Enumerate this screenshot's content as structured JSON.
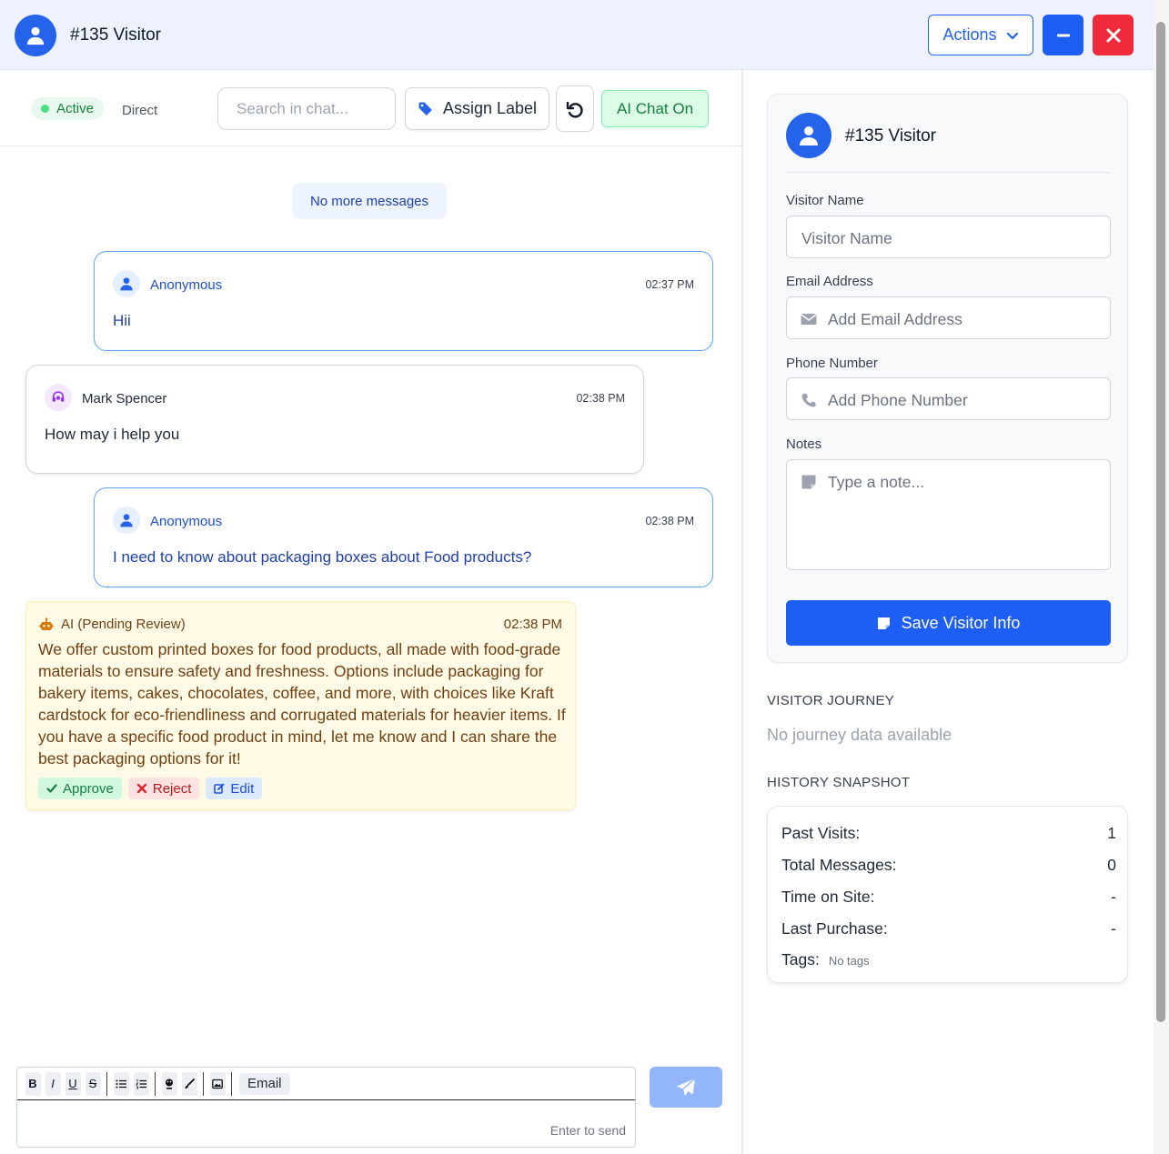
{
  "header": {
    "title": "#135 Visitor",
    "actions_label": "Actions"
  },
  "toolbar": {
    "status": "Active",
    "channel": "Direct",
    "search_placeholder": "Search in chat...",
    "assign_label": "Assign Label",
    "ai_chat_label": "AI Chat On"
  },
  "chat": {
    "no_more_label": "No more messages",
    "messages": [
      {
        "sender": "Anonymous",
        "time": "02:37 PM",
        "text": "Hii"
      },
      {
        "sender": "Mark Spencer",
        "time": "02:38 PM",
        "text": "How may i help you"
      },
      {
        "sender": "Anonymous",
        "time": "02:38 PM",
        "text": "I need to know about packaging boxes about Food products?"
      }
    ],
    "ai_message": {
      "sender": "AI (Pending Review)",
      "time": "02:38 PM",
      "text": "We offer custom printed boxes for food products, all made with food-grade materials to ensure safety and freshness. Options include packaging for bakery items, cakes, chocolates, coffee, and more, with choices like Kraft cardstock for eco-friendliness and corrugated materials for heavier items. If you have a specific food product in mind, let me know and I can share the best packaging options for it!",
      "approve_label": "Approve",
      "reject_label": "Reject",
      "edit_label": "Edit"
    }
  },
  "composer": {
    "toolbar": {
      "bold": "B",
      "italic": "I",
      "underline": "U",
      "strike": "S",
      "email_label": "Email"
    },
    "hint": "Enter to send"
  },
  "visitor_info": {
    "title": "#135 Visitor",
    "name_label": "Visitor Name",
    "name_placeholder": "Visitor Name",
    "email_label": "Email Address",
    "email_placeholder": "Add Email Address",
    "phone_label": "Phone Number",
    "phone_placeholder": "Add Phone Number",
    "notes_label": "Notes",
    "notes_placeholder": "Type a note...",
    "save_label": "Save Visitor Info"
  },
  "journey": {
    "title": "VISITOR JOURNEY",
    "empty": "No journey data available"
  },
  "history": {
    "title": "HISTORY SNAPSHOT",
    "rows": [
      {
        "label": "Past Visits:",
        "value": "1"
      },
      {
        "label": "Total Messages:",
        "value": "0"
      },
      {
        "label": "Time on Site:",
        "value": "-"
      },
      {
        "label": "Last Purchase:",
        "value": "-"
      }
    ],
    "tags_label": "Tags:",
    "tags_value": "No tags"
  },
  "colors": {
    "primary": "#1d5ef5",
    "danger": "#ef2b3c",
    "success": "#15803d",
    "ai_bg": "#fefae6"
  }
}
